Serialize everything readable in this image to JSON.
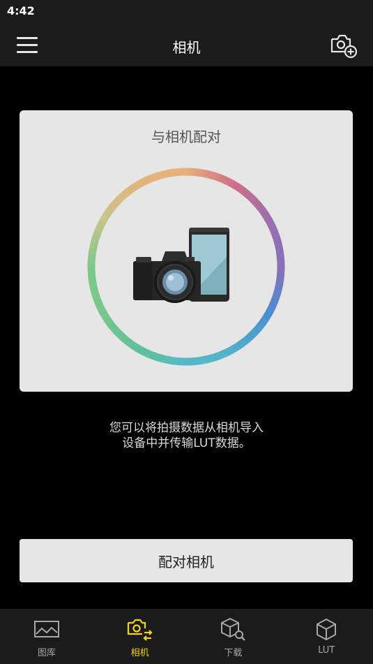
{
  "status_bar": {
    "time": "4:42"
  },
  "app_bar": {
    "title": "相机",
    "menu_icon": "hamburger-menu-icon",
    "add_camera_icon": "add-camera-icon"
  },
  "pair_card": {
    "title": "与相机配对",
    "illustration": "camera-phone-ring-illustration"
  },
  "description": {
    "line1": "您可以将拍摄数据从相机导入",
    "line2": "设备中并传输LUT数据。"
  },
  "pair_button": {
    "label": "配对相机"
  },
  "bottom_nav": {
    "items": [
      {
        "label": "图库",
        "icon": "gallery-icon",
        "active": false
      },
      {
        "label": "相机",
        "icon": "camera-transfer-icon",
        "active": true
      },
      {
        "label": "下载",
        "icon": "download-search-icon",
        "active": false
      },
      {
        "label": "LUT",
        "icon": "lut-cube-icon",
        "active": false
      }
    ]
  },
  "colors": {
    "background": "#000000",
    "bar": "#1b1b1b",
    "card": "#e6e6e6",
    "accent_active": "#f5d215",
    "nav_inactive": "#a8a8a8"
  }
}
